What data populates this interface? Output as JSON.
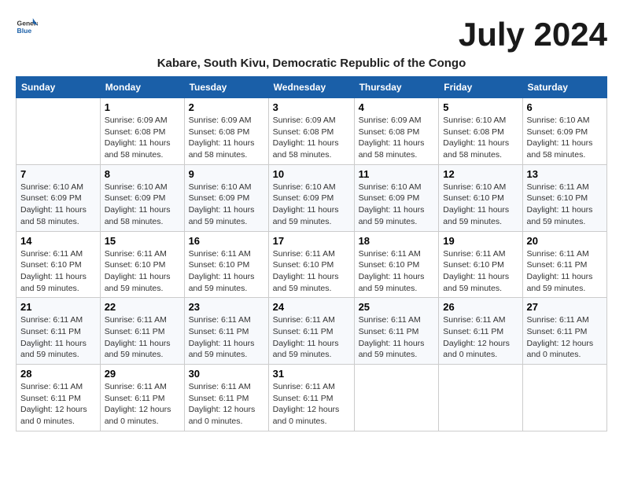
{
  "header": {
    "logo_general": "General",
    "logo_blue": "Blue",
    "month": "July 2024",
    "location": "Kabare, South Kivu, Democratic Republic of the Congo"
  },
  "days_of_week": [
    "Sunday",
    "Monday",
    "Tuesday",
    "Wednesday",
    "Thursday",
    "Friday",
    "Saturday"
  ],
  "weeks": [
    [
      {
        "day": "",
        "info": ""
      },
      {
        "day": "1",
        "info": "Sunrise: 6:09 AM\nSunset: 6:08 PM\nDaylight: 11 hours and 58 minutes."
      },
      {
        "day": "2",
        "info": "Sunrise: 6:09 AM\nSunset: 6:08 PM\nDaylight: 11 hours and 58 minutes."
      },
      {
        "day": "3",
        "info": "Sunrise: 6:09 AM\nSunset: 6:08 PM\nDaylight: 11 hours and 58 minutes."
      },
      {
        "day": "4",
        "info": "Sunrise: 6:09 AM\nSunset: 6:08 PM\nDaylight: 11 hours and 58 minutes."
      },
      {
        "day": "5",
        "info": "Sunrise: 6:10 AM\nSunset: 6:08 PM\nDaylight: 11 hours and 58 minutes."
      },
      {
        "day": "6",
        "info": "Sunrise: 6:10 AM\nSunset: 6:09 PM\nDaylight: 11 hours and 58 minutes."
      }
    ],
    [
      {
        "day": "7",
        "info": "Sunrise: 6:10 AM\nSunset: 6:09 PM\nDaylight: 11 hours and 58 minutes."
      },
      {
        "day": "8",
        "info": "Sunrise: 6:10 AM\nSunset: 6:09 PM\nDaylight: 11 hours and 58 minutes."
      },
      {
        "day": "9",
        "info": "Sunrise: 6:10 AM\nSunset: 6:09 PM\nDaylight: 11 hours and 59 minutes."
      },
      {
        "day": "10",
        "info": "Sunrise: 6:10 AM\nSunset: 6:09 PM\nDaylight: 11 hours and 59 minutes."
      },
      {
        "day": "11",
        "info": "Sunrise: 6:10 AM\nSunset: 6:09 PM\nDaylight: 11 hours and 59 minutes."
      },
      {
        "day": "12",
        "info": "Sunrise: 6:10 AM\nSunset: 6:10 PM\nDaylight: 11 hours and 59 minutes."
      },
      {
        "day": "13",
        "info": "Sunrise: 6:11 AM\nSunset: 6:10 PM\nDaylight: 11 hours and 59 minutes."
      }
    ],
    [
      {
        "day": "14",
        "info": "Sunrise: 6:11 AM\nSunset: 6:10 PM\nDaylight: 11 hours and 59 minutes."
      },
      {
        "day": "15",
        "info": "Sunrise: 6:11 AM\nSunset: 6:10 PM\nDaylight: 11 hours and 59 minutes."
      },
      {
        "day": "16",
        "info": "Sunrise: 6:11 AM\nSunset: 6:10 PM\nDaylight: 11 hours and 59 minutes."
      },
      {
        "day": "17",
        "info": "Sunrise: 6:11 AM\nSunset: 6:10 PM\nDaylight: 11 hours and 59 minutes."
      },
      {
        "day": "18",
        "info": "Sunrise: 6:11 AM\nSunset: 6:10 PM\nDaylight: 11 hours and 59 minutes."
      },
      {
        "day": "19",
        "info": "Sunrise: 6:11 AM\nSunset: 6:10 PM\nDaylight: 11 hours and 59 minutes."
      },
      {
        "day": "20",
        "info": "Sunrise: 6:11 AM\nSunset: 6:11 PM\nDaylight: 11 hours and 59 minutes."
      }
    ],
    [
      {
        "day": "21",
        "info": "Sunrise: 6:11 AM\nSunset: 6:11 PM\nDaylight: 11 hours and 59 minutes."
      },
      {
        "day": "22",
        "info": "Sunrise: 6:11 AM\nSunset: 6:11 PM\nDaylight: 11 hours and 59 minutes."
      },
      {
        "day": "23",
        "info": "Sunrise: 6:11 AM\nSunset: 6:11 PM\nDaylight: 11 hours and 59 minutes."
      },
      {
        "day": "24",
        "info": "Sunrise: 6:11 AM\nSunset: 6:11 PM\nDaylight: 11 hours and 59 minutes."
      },
      {
        "day": "25",
        "info": "Sunrise: 6:11 AM\nSunset: 6:11 PM\nDaylight: 11 hours and 59 minutes."
      },
      {
        "day": "26",
        "info": "Sunrise: 6:11 AM\nSunset: 6:11 PM\nDaylight: 12 hours and 0 minutes."
      },
      {
        "day": "27",
        "info": "Sunrise: 6:11 AM\nSunset: 6:11 PM\nDaylight: 12 hours and 0 minutes."
      }
    ],
    [
      {
        "day": "28",
        "info": "Sunrise: 6:11 AM\nSunset: 6:11 PM\nDaylight: 12 hours and 0 minutes."
      },
      {
        "day": "29",
        "info": "Sunrise: 6:11 AM\nSunset: 6:11 PM\nDaylight: 12 hours and 0 minutes."
      },
      {
        "day": "30",
        "info": "Sunrise: 6:11 AM\nSunset: 6:11 PM\nDaylight: 12 hours and 0 minutes."
      },
      {
        "day": "31",
        "info": "Sunrise: 6:11 AM\nSunset: 6:11 PM\nDaylight: 12 hours and 0 minutes."
      },
      {
        "day": "",
        "info": ""
      },
      {
        "day": "",
        "info": ""
      },
      {
        "day": "",
        "info": ""
      }
    ]
  ]
}
